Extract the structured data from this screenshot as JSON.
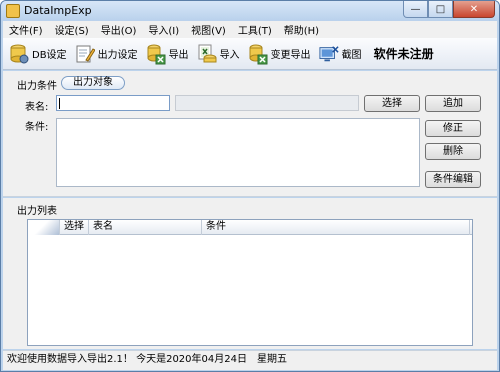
{
  "window": {
    "title": "DataImpExp"
  },
  "menu": [
    "文件(F)",
    "设定(S)",
    "导出(O)",
    "导入(I)",
    "视图(V)",
    "工具(T)",
    "帮助(H)"
  ],
  "toolbar": {
    "db_settings": "DB设定",
    "output_settings": "出力设定",
    "export": "导出",
    "import": "导入",
    "change_export": "变更导出",
    "screenshot": "截图",
    "unregistered": "软件未注册"
  },
  "output_conditions": {
    "section_label": "出力条件",
    "tab_label": "出力对象",
    "table_name_label": "表名:",
    "table_name_value": "",
    "condition_label": "条件:",
    "select_button": "选择",
    "add_button": "追加",
    "modify_button": "修正",
    "delete_button": "删除",
    "edit_condition_button": "条件编辑"
  },
  "output_list": {
    "section_label": "出力列表",
    "columns": [
      "选择",
      "表名",
      "条件"
    ]
  },
  "status": {
    "text": "欢迎使用数据导入导出2.1！ 今天是2020年04月24日　星期五"
  }
}
